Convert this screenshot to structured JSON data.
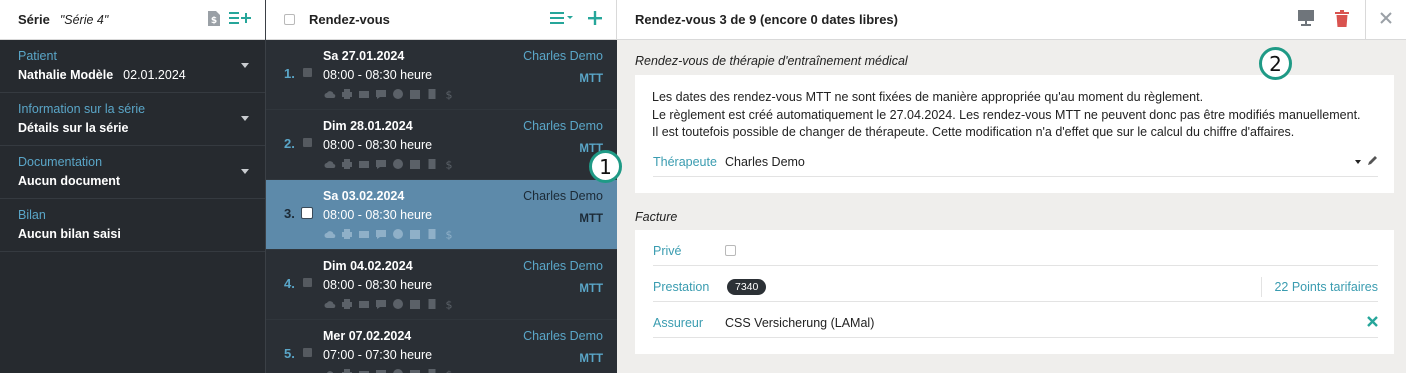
{
  "series": {
    "label": "Série",
    "name": "\"Série 4\"",
    "sections": [
      {
        "title": "Patient",
        "value": "Nathalie  Modèle",
        "extra": "02.01.2024"
      },
      {
        "title": "Information sur la série",
        "value": "Détails sur la série",
        "extra": ""
      },
      {
        "title": "Documentation",
        "value": "Aucun document",
        "extra": ""
      },
      {
        "title": "Bilan",
        "value": "Aucun bilan saisi",
        "extra": ""
      }
    ]
  },
  "appointments": {
    "title": "Rendez-vous",
    "items": [
      {
        "num": "1.",
        "date": "Sa 27.01.2024",
        "time": "08:00 - 08:30 heure",
        "therapist": "Charles Demo",
        "type": "MTT"
      },
      {
        "num": "2.",
        "date": "Dim 28.01.2024",
        "time": "08:00 - 08:30 heure",
        "therapist": "Charles Demo",
        "type": "MTT"
      },
      {
        "num": "3.",
        "date": "Sa 03.02.2024",
        "time": "08:00 - 08:30 heure",
        "therapist": "Charles Demo",
        "type": "MTT"
      },
      {
        "num": "4.",
        "date": "Dim 04.02.2024",
        "time": "08:00 - 08:30 heure",
        "therapist": "Charles Demo",
        "type": "MTT"
      },
      {
        "num": "5.",
        "date": "Mer 07.02.2024",
        "time": "07:00 - 07:30 heure",
        "therapist": "Charles Demo",
        "type": "MTT"
      }
    ],
    "selected_index": 2
  },
  "detail": {
    "title": "Rendez-vous 3 de 9 (encore 0 dates libres)",
    "section_title": "Rendez-vous de thérapie d'entraînement médical",
    "info_lines": [
      "Les dates des rendez-vous MTT ne sont fixées de manière appropriée qu'au moment du règlement.",
      "Le règlement est créé automatiquement le 27.04.2024. Les rendez-vous MTT ne peuvent donc pas être modifiés manuellement.",
      "Il est toutefois possible de changer de thérapeute. Cette modification n'a d'effet que sur le calcul du chiffre d'affaires."
    ],
    "therapist_label": "Thérapeute",
    "therapist_value": "Charles Demo",
    "invoice_title": "Facture",
    "private_label": "Privé",
    "service_label": "Prestation",
    "service_code": "7340",
    "tariff_points": "22 Points tarifaires",
    "insurer_label": "Assureur",
    "insurer_value": "CSS Versicherung (LAMal)"
  },
  "markers": {
    "one": "1",
    "two": "2"
  },
  "colors": {
    "accent": "#3a9cb0",
    "dark_panel": "#2a2f35",
    "selected": "#5d8aaa",
    "delete": "#d9534f"
  },
  "icons": [
    "document-icon",
    "add-list-icon",
    "list-menu-icon",
    "plus-icon",
    "presentation-icon",
    "trash-icon",
    "close-icon",
    "pencil-icon",
    "remove-icon"
  ]
}
